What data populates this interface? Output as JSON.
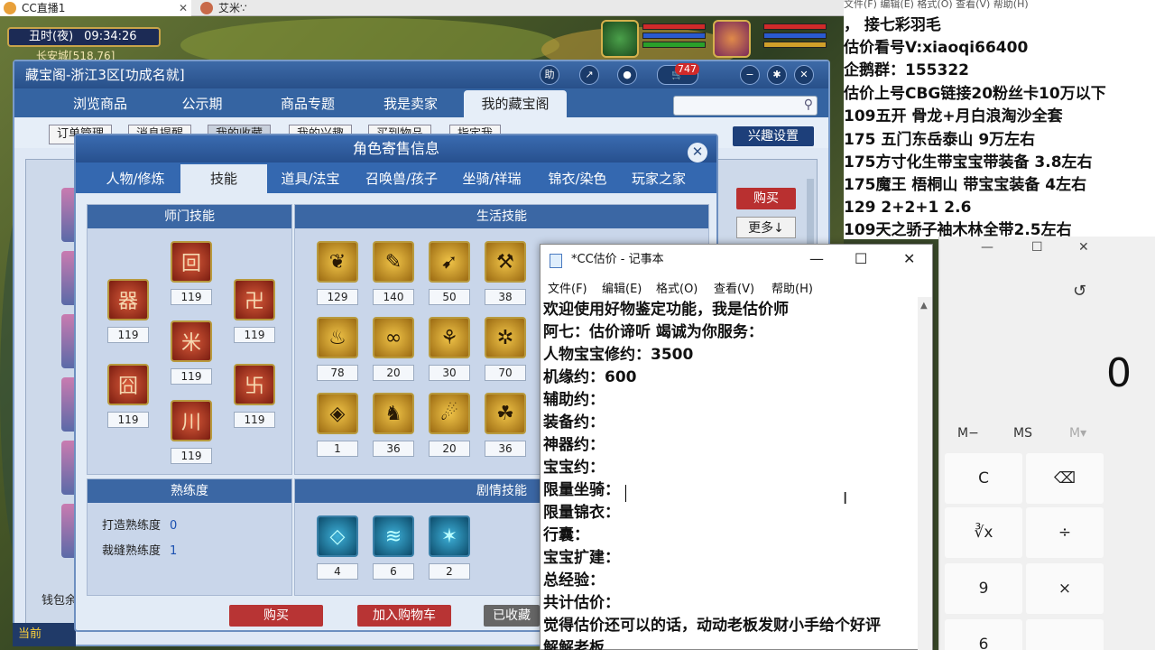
{
  "browser_tabs": [
    {
      "label": "CC直播1"
    },
    {
      "label": "艾米∵"
    }
  ],
  "game": {
    "clock_period": "丑时(夜)",
    "clock_time": "09:34:26",
    "location": "长安城[518,76]",
    "bottom_label": "当前"
  },
  "cbg_window": {
    "title": "藏宝阁-浙江3区[功成名就]",
    "help_label": "助",
    "cart_count": "747",
    "nav_tabs": [
      "浏览商品",
      "公示期",
      "商品专题",
      "我是卖家",
      "我的藏宝阁"
    ],
    "sub_tabs": [
      "订单管理",
      "消息提醒",
      "我的收藏",
      "我的兴趣",
      "买到物品",
      "指定我"
    ],
    "interest_button": "兴趣设置",
    "buy_button": "购买",
    "more_button": "更多↓",
    "wallet_label": "钱包余"
  },
  "role_dialog": {
    "title": "角色寄售信息",
    "tabs": [
      "人物/修炼",
      "技能",
      "道具/法宝",
      "召唤兽/孩子",
      "坐骑/祥瑞",
      "锦衣/染色",
      "玩家之家"
    ],
    "school_skills_title": "师门技能",
    "school_skills": [
      "119",
      "119",
      "119",
      "119",
      "119",
      "119",
      "119"
    ],
    "life_skills_title": "生活技能",
    "life_skills": [
      "129",
      "140",
      "50",
      "38",
      "78",
      "20",
      "30",
      "70",
      "1",
      "36",
      "20",
      "36"
    ],
    "proficiency_title": "熟练度",
    "proficiency": [
      {
        "label": "打造熟练度",
        "value": "0"
      },
      {
        "label": "裁缝熟练度",
        "value": "1"
      }
    ],
    "story_skills_title": "剧情技能",
    "story_skills": [
      "4",
      "6",
      "2"
    ],
    "buttons": {
      "buy": "购买",
      "add_cart": "加入购物车",
      "collected": "已收藏"
    }
  },
  "overlay_text": {
    "menu": "文件(F)  编辑(E)  格式(O)  查看(V)  帮助(H)",
    "lines": [
      "，    接七彩羽毛",
      "估价看号V:xiaoqi66400",
      "企鹅群：155322",
      "估价上号CBG链接20粉丝卡10万以下",
      "109五开 骨龙+月白浪淘沙全套",
      "175 五门东岳泰山  9万左右",
      "175方寸化生带宝宝带装备  3.8左右",
      "175魔王 梧桐山  带宝宝装备 4左右",
      "129 2+2+1  2.6",
      "109天之骄子袖木林全带2.5左右"
    ]
  },
  "notepad": {
    "title": "*CC估价 - 记事本",
    "menu": [
      "文件(F)",
      "编辑(E)",
      "格式(O)",
      "查看(V)",
      "帮助(H)"
    ],
    "lines": [
      "欢迎使用好物鉴定功能，我是估价师",
      "阿七：估价谛听 竭诚为你服务：",
      "人物宝宝修约：3500",
      "机缘约：600",
      "辅助约：",
      "装备约：",
      "神器约：",
      "宝宝约：",
      "限量坐骑：",
      "限量锦衣：",
      "行囊：",
      "宝宝扩建：",
      "总经验：",
      "共计估价：",
      "觉得估价还可以的话，动动老板发财小手给个好评",
      "解解老板"
    ]
  },
  "calculator": {
    "display": "0",
    "memory": [
      "M−",
      "MS",
      "M▾"
    ],
    "keys": [
      "C",
      "⌫",
      "∛x",
      "÷",
      "9",
      "×",
      "6"
    ]
  }
}
